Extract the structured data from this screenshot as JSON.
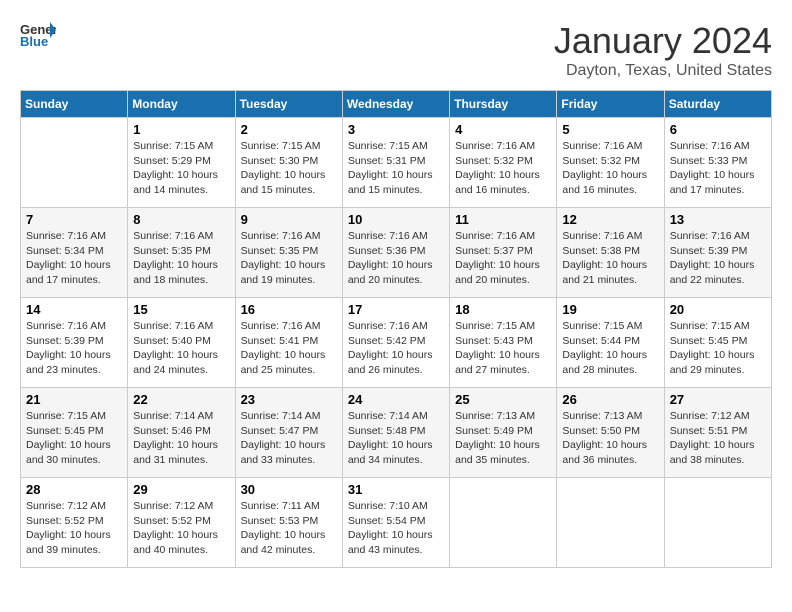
{
  "header": {
    "logo_line1": "General",
    "logo_line2": "Blue",
    "month_title": "January 2024",
    "location": "Dayton, Texas, United States"
  },
  "days_of_week": [
    "Sunday",
    "Monday",
    "Tuesday",
    "Wednesday",
    "Thursday",
    "Friday",
    "Saturday"
  ],
  "weeks": [
    [
      {
        "day": "",
        "info": ""
      },
      {
        "day": "1",
        "info": "Sunrise: 7:15 AM\nSunset: 5:29 PM\nDaylight: 10 hours\nand 14 minutes."
      },
      {
        "day": "2",
        "info": "Sunrise: 7:15 AM\nSunset: 5:30 PM\nDaylight: 10 hours\nand 15 minutes."
      },
      {
        "day": "3",
        "info": "Sunrise: 7:15 AM\nSunset: 5:31 PM\nDaylight: 10 hours\nand 15 minutes."
      },
      {
        "day": "4",
        "info": "Sunrise: 7:16 AM\nSunset: 5:32 PM\nDaylight: 10 hours\nand 16 minutes."
      },
      {
        "day": "5",
        "info": "Sunrise: 7:16 AM\nSunset: 5:32 PM\nDaylight: 10 hours\nand 16 minutes."
      },
      {
        "day": "6",
        "info": "Sunrise: 7:16 AM\nSunset: 5:33 PM\nDaylight: 10 hours\nand 17 minutes."
      }
    ],
    [
      {
        "day": "7",
        "info": "Sunrise: 7:16 AM\nSunset: 5:34 PM\nDaylight: 10 hours\nand 17 minutes."
      },
      {
        "day": "8",
        "info": "Sunrise: 7:16 AM\nSunset: 5:35 PM\nDaylight: 10 hours\nand 18 minutes."
      },
      {
        "day": "9",
        "info": "Sunrise: 7:16 AM\nSunset: 5:35 PM\nDaylight: 10 hours\nand 19 minutes."
      },
      {
        "day": "10",
        "info": "Sunrise: 7:16 AM\nSunset: 5:36 PM\nDaylight: 10 hours\nand 20 minutes."
      },
      {
        "day": "11",
        "info": "Sunrise: 7:16 AM\nSunset: 5:37 PM\nDaylight: 10 hours\nand 20 minutes."
      },
      {
        "day": "12",
        "info": "Sunrise: 7:16 AM\nSunset: 5:38 PM\nDaylight: 10 hours\nand 21 minutes."
      },
      {
        "day": "13",
        "info": "Sunrise: 7:16 AM\nSunset: 5:39 PM\nDaylight: 10 hours\nand 22 minutes."
      }
    ],
    [
      {
        "day": "14",
        "info": "Sunrise: 7:16 AM\nSunset: 5:39 PM\nDaylight: 10 hours\nand 23 minutes."
      },
      {
        "day": "15",
        "info": "Sunrise: 7:16 AM\nSunset: 5:40 PM\nDaylight: 10 hours\nand 24 minutes."
      },
      {
        "day": "16",
        "info": "Sunrise: 7:16 AM\nSunset: 5:41 PM\nDaylight: 10 hours\nand 25 minutes."
      },
      {
        "day": "17",
        "info": "Sunrise: 7:16 AM\nSunset: 5:42 PM\nDaylight: 10 hours\nand 26 minutes."
      },
      {
        "day": "18",
        "info": "Sunrise: 7:15 AM\nSunset: 5:43 PM\nDaylight: 10 hours\nand 27 minutes."
      },
      {
        "day": "19",
        "info": "Sunrise: 7:15 AM\nSunset: 5:44 PM\nDaylight: 10 hours\nand 28 minutes."
      },
      {
        "day": "20",
        "info": "Sunrise: 7:15 AM\nSunset: 5:45 PM\nDaylight: 10 hours\nand 29 minutes."
      }
    ],
    [
      {
        "day": "21",
        "info": "Sunrise: 7:15 AM\nSunset: 5:45 PM\nDaylight: 10 hours\nand 30 minutes."
      },
      {
        "day": "22",
        "info": "Sunrise: 7:14 AM\nSunset: 5:46 PM\nDaylight: 10 hours\nand 31 minutes."
      },
      {
        "day": "23",
        "info": "Sunrise: 7:14 AM\nSunset: 5:47 PM\nDaylight: 10 hours\nand 33 minutes."
      },
      {
        "day": "24",
        "info": "Sunrise: 7:14 AM\nSunset: 5:48 PM\nDaylight: 10 hours\nand 34 minutes."
      },
      {
        "day": "25",
        "info": "Sunrise: 7:13 AM\nSunset: 5:49 PM\nDaylight: 10 hours\nand 35 minutes."
      },
      {
        "day": "26",
        "info": "Sunrise: 7:13 AM\nSunset: 5:50 PM\nDaylight: 10 hours\nand 36 minutes."
      },
      {
        "day": "27",
        "info": "Sunrise: 7:12 AM\nSunset: 5:51 PM\nDaylight: 10 hours\nand 38 minutes."
      }
    ],
    [
      {
        "day": "28",
        "info": "Sunrise: 7:12 AM\nSunset: 5:52 PM\nDaylight: 10 hours\nand 39 minutes."
      },
      {
        "day": "29",
        "info": "Sunrise: 7:12 AM\nSunset: 5:52 PM\nDaylight: 10 hours\nand 40 minutes."
      },
      {
        "day": "30",
        "info": "Sunrise: 7:11 AM\nSunset: 5:53 PM\nDaylight: 10 hours\nand 42 minutes."
      },
      {
        "day": "31",
        "info": "Sunrise: 7:10 AM\nSunset: 5:54 PM\nDaylight: 10 hours\nand 43 minutes."
      },
      {
        "day": "",
        "info": ""
      },
      {
        "day": "",
        "info": ""
      },
      {
        "day": "",
        "info": ""
      }
    ]
  ]
}
